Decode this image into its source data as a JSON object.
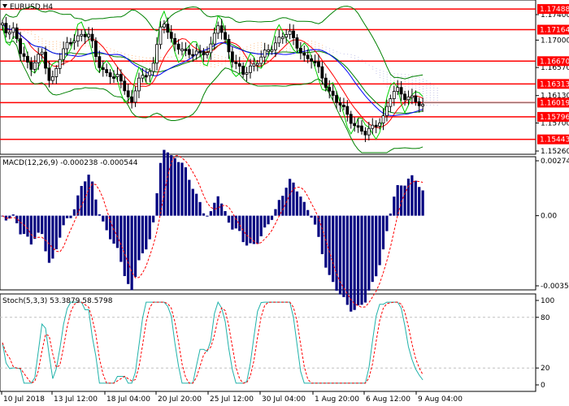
{
  "main": {
    "symbol": "EURUSD,H4",
    "ticks": [
      "1.17400",
      "1.17000",
      "1.16570",
      "1.16130",
      "1.15700",
      "1.15260"
    ],
    "tick_values": [
      1.174,
      1.17,
      1.1657,
      1.1613,
      1.157,
      1.1526
    ],
    "levels": [
      {
        "label": "1.17488",
        "value": 1.17488
      },
      {
        "label": "1.17164",
        "value": 1.17164
      },
      {
        "label": "1.16670",
        "value": 1.1667
      },
      {
        "label": "1.16313",
        "value": 1.16313
      },
      {
        "label": "1.16019",
        "value": 1.16019
      },
      {
        "label": "1.15796",
        "value": 1.15796
      },
      {
        "label": "1.15443",
        "value": 1.15443
      }
    ]
  },
  "macd": {
    "label": "MACD(12,26,9) -0.000238 -0.000544",
    "ticks": [
      "0.00274",
      "0.00",
      "-0.00350"
    ],
    "tick_values": [
      0.00274,
      0.0,
      -0.0035
    ]
  },
  "stoch": {
    "label": "Stoch(5,3,3) 53.3879 58.5798",
    "ticks": [
      "100",
      "80",
      "20",
      "0"
    ],
    "tick_values": [
      100,
      80,
      20,
      0
    ]
  },
  "xaxis": {
    "labels": [
      "10 Jul 2018",
      "13 Jul 12:00",
      "18 Jul 04:00",
      "20 Jul 20:00",
      "25 Jul 12:00",
      "30 Jul 04:00",
      "1 Aug 20:00",
      "6 Aug 12:00",
      "9 Aug 04:00"
    ]
  },
  "colors": {
    "level_line": "#ff0000",
    "level_label_bg": "#ff0000",
    "candles": "#000000",
    "bollinger": "#008000",
    "ma_red": "#ff0000",
    "ma_blue": "#0000ff",
    "cloud_a": "#ffa860",
    "cloud_b": "#b0b0e0",
    "macd_hist": "#000080",
    "signal": "#ff0000",
    "stoch_main": "#20b2aa",
    "stoch_signal": "#ff0000",
    "level_dash": "#c0c0c0"
  }
}
